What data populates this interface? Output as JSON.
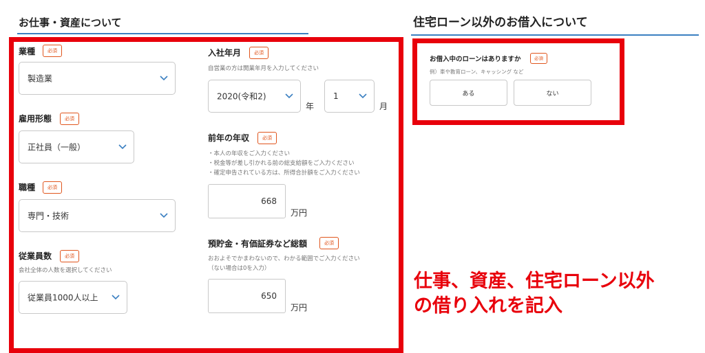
{
  "left_section": {
    "title": "お仕事・資産について",
    "required_badge": "必須",
    "industry": {
      "label": "業種",
      "value": "製造業"
    },
    "employment_type": {
      "label": "雇用形態",
      "value": "正社員（一般）"
    },
    "occupation": {
      "label": "職種",
      "value": "専門・技術"
    },
    "employees": {
      "label": "従業員数",
      "hint": "会社全体の人数を選択してください",
      "value": "従業員1000人以上"
    },
    "join_date": {
      "label": "入社年月",
      "hint": "自営業の方は開業年月を入力してください",
      "year_value": "2020(令和2)",
      "year_unit": "年",
      "month_value": "1",
      "month_unit": "月"
    },
    "annual_income": {
      "label": "前年の年収",
      "hints": [
        "・本人の年収をご入力ください",
        "・税金等が差し引かれる前の総支給額をご入力ください",
        "・確定申告されている方は、所得合計額をご入力ください"
      ],
      "value": "668",
      "unit": "万円"
    },
    "savings": {
      "label": "預貯金・有価証券など総額",
      "hints": [
        "おおよそでかまわないので、わかる範囲でご入力ください",
        "（ない場合は0を入力）"
      ],
      "value": "650",
      "unit": "万円"
    }
  },
  "right_section": {
    "title": "住宅ローン以外のお借入について",
    "question": "お借入中のローンはありますか",
    "required_badge": "必須",
    "hint": "例）車や教育ローン、キャッシング など",
    "yes_label": "ある",
    "no_label": "ない"
  },
  "annotation": {
    "line1": "仕事、資産、住宅ローン以外",
    "line2": "の借り入れを記入"
  },
  "colors": {
    "frame": "#e8000b",
    "badge": "#e0541b",
    "underline": "#3a7fc1",
    "chevron": "#3a7fc1"
  }
}
